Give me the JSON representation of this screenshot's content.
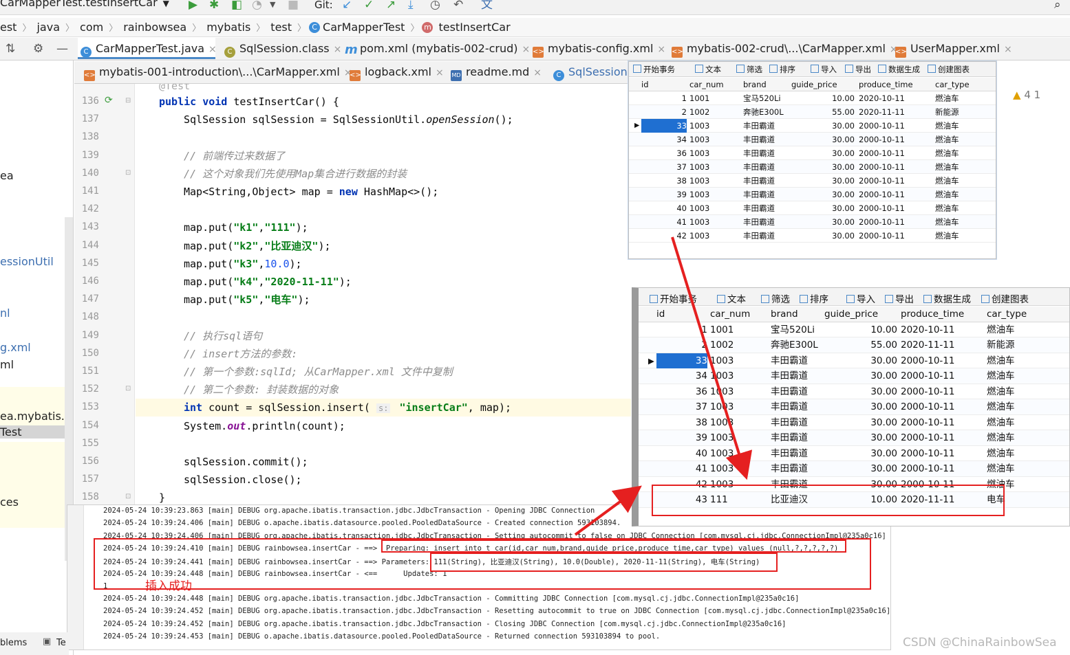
{
  "toolbar": {
    "run_config": "CarMapperTest.testInsertCar",
    "git_label": "Git:"
  },
  "breadcrumb": {
    "items": [
      "est",
      "java",
      "com",
      "rainbowsea",
      "mybatis",
      "test",
      "CarMapperTest",
      "testInsertCar"
    ]
  },
  "tabs_row1": [
    {
      "label": "CarMapperTest.java",
      "icon": "class-icon"
    },
    {
      "label": "SqlSession.class",
      "icon": "class-icon"
    },
    {
      "label": "pom.xml (mybatis-002-crud)",
      "icon": "maven-icon"
    },
    {
      "label": "mybatis-config.xml",
      "icon": "xml-icon"
    },
    {
      "label": "mybatis-002-crud\\...\\CarMapper.xml",
      "icon": "xml-icon"
    },
    {
      "label": "UserMapper.xml",
      "icon": "xml-icon"
    }
  ],
  "tabs_row2": [
    {
      "label": "mybatis-001-introduction\\...\\CarMapper.xml",
      "icon": "xml-icon"
    },
    {
      "label": "logback.xml",
      "icon": "xml-icon"
    },
    {
      "label": "readme.md",
      "icon": "markdown-icon"
    },
    {
      "label": "SqlSessionU",
      "icon": "class-icon"
    }
  ],
  "project_panel": {
    "items": [
      "ea",
      "essionUtil",
      "nl",
      "g.xml",
      "ml",
      "ea.mybatis.tes",
      "Test",
      "ces"
    ]
  },
  "editor": {
    "lines": [
      {
        "n": "136",
        "text": "public void testInsertCar() {"
      },
      {
        "n": "137",
        "text": "SqlSession sqlSession = SqlSessionUtil.openSession();"
      },
      {
        "n": "138",
        "text": ""
      },
      {
        "n": "139",
        "text": "// 前端传过来数据了"
      },
      {
        "n": "140",
        "text": "// 这个对象我们先使用Map集合进行数据的封装"
      },
      {
        "n": "141",
        "text": "Map<String,Object> map = new HashMap<>();"
      },
      {
        "n": "142",
        "text": ""
      },
      {
        "n": "143",
        "text": "map.put(\"k1\",\"111\");"
      },
      {
        "n": "144",
        "text": "map.put(\"k2\",\"比亚迪汉\");"
      },
      {
        "n": "145",
        "text": "map.put(\"k3\",10.0);"
      },
      {
        "n": "146",
        "text": "map.put(\"k4\",\"2020-11-11\");"
      },
      {
        "n": "147",
        "text": "map.put(\"k5\",\"电车\");"
      },
      {
        "n": "148",
        "text": ""
      },
      {
        "n": "149",
        "text": "// 执行sql语句"
      },
      {
        "n": "150",
        "text": "// insert方法的参数:"
      },
      {
        "n": "151",
        "text": "// 第一个参数:sqlId; 从CarMapper.xml 文件中复制"
      },
      {
        "n": "152",
        "text": "// 第二个参数: 封装数据的对象"
      },
      {
        "n": "153",
        "text": "int count = sqlSession.insert( s: \"insertCar\", map);"
      },
      {
        "n": "154",
        "text": "System.out.println(count);"
      },
      {
        "n": "155",
        "text": ""
      },
      {
        "n": "156",
        "text": "sqlSession.commit();"
      },
      {
        "n": "157",
        "text": "sqlSession.close();"
      },
      {
        "n": "158",
        "text": "}"
      }
    ],
    "inspections": "4  1"
  },
  "console": {
    "lines": [
      "2024-05-24 10:39:23.863 [main] DEBUG org.apache.ibatis.transaction.jdbc.JdbcTransaction - Opening JDBC Connection",
      "2024-05-24 10:39:24.406 [main] DEBUG o.apache.ibatis.datasource.pooled.PooledDataSource - Created connection 593103894.",
      "2024-05-24 10:39:24.406 [main] DEBUG org.apache.ibatis.transaction.jdbc.JdbcTransaction - Setting autocommit to false on JDBC Connection [com.mysql.cj.jdbc.ConnectionImpl@235a0c16]",
      "2024-05-24 10:39:24.410 [main] DEBUG rainbowsea.insertCar - ==>  Preparing: insert into t_car(id,car_num,brand,guide_price,produce_time,car_type) values (null,?,?,?,?,?)",
      "2024-05-24 10:39:24.441 [main] DEBUG rainbowsea.insertCar - ==> Parameters: 111(String), 比亚迪汉(String), 10.0(Double), 2020-11-11(String), 电车(String)",
      "2024-05-24 10:39:24.448 [main] DEBUG rainbowsea.insertCar - <==      Updates: 1",
      "1",
      "2024-05-24 10:39:24.448 [main] DEBUG org.apache.ibatis.transaction.jdbc.JdbcTransaction - Committing JDBC Connection [com.mysql.cj.jdbc.ConnectionImpl@235a0c16]",
      "2024-05-24 10:39:24.452 [main] DEBUG org.apache.ibatis.transaction.jdbc.JdbcTransaction - Resetting autocommit to true on JDBC Connection [com.mysql.cj.jdbc.ConnectionImpl@235a0c16]",
      "2024-05-24 10:39:24.452 [main] DEBUG org.apache.ibatis.transaction.jdbc.JdbcTransaction - Closing JDBC Connection [com.mysql.cj.jdbc.ConnectionImpl@235a0c16]",
      "2024-05-24 10:39:24.453 [main] DEBUG o.apache.ibatis.datasource.pooled.PooledDataSource - Returned connection 593103894 to pool."
    ],
    "annotation": "插入成功"
  },
  "bottom_tabs": [
    "blems",
    "Te"
  ],
  "db_toolbar": [
    "开始事务",
    "文本",
    "筛选",
    "排序",
    "导入",
    "导出",
    "数据生成",
    "创建图表"
  ],
  "db_columns": [
    "id",
    "car_num",
    "brand",
    "guide_price",
    "produce_time",
    "car_type"
  ],
  "db_before": [
    [
      "1",
      "1001",
      "宝马520Li",
      "10.00",
      "2020-10-11",
      "燃油车"
    ],
    [
      "2",
      "1002",
      "奔驰E300L",
      "55.00",
      "2020-11-11",
      "新能源"
    ],
    [
      "33",
      "1003",
      "丰田霸道",
      "30.00",
      "2000-10-11",
      "燃油车"
    ],
    [
      "34",
      "1003",
      "丰田霸道",
      "30.00",
      "2000-10-11",
      "燃油车"
    ],
    [
      "36",
      "1003",
      "丰田霸道",
      "30.00",
      "2000-10-11",
      "燃油车"
    ],
    [
      "37",
      "1003",
      "丰田霸道",
      "30.00",
      "2000-10-11",
      "燃油车"
    ],
    [
      "38",
      "1003",
      "丰田霸道",
      "30.00",
      "2000-10-11",
      "燃油车"
    ],
    [
      "39",
      "1003",
      "丰田霸道",
      "30.00",
      "2000-10-11",
      "燃油车"
    ],
    [
      "40",
      "1003",
      "丰田霸道",
      "30.00",
      "2000-10-11",
      "燃油车"
    ],
    [
      "41",
      "1003",
      "丰田霸道",
      "30.00",
      "2000-10-11",
      "燃油车"
    ],
    [
      "42",
      "1003",
      "丰田霸道",
      "30.00",
      "2000-10-11",
      "燃油车"
    ]
  ],
  "db_after": [
    [
      "1",
      "1001",
      "宝马520Li",
      "10.00",
      "2020-10-11",
      "燃油车"
    ],
    [
      "2",
      "1002",
      "奔驰E300L",
      "55.00",
      "2020-11-11",
      "新能源"
    ],
    [
      "33",
      "1003",
      "丰田霸道",
      "30.00",
      "2000-10-11",
      "燃油车"
    ],
    [
      "34",
      "1003",
      "丰田霸道",
      "30.00",
      "2000-10-11",
      "燃油车"
    ],
    [
      "36",
      "1003",
      "丰田霸道",
      "30.00",
      "2000-10-11",
      "燃油车"
    ],
    [
      "37",
      "1003",
      "丰田霸道",
      "30.00",
      "2000-10-11",
      "燃油车"
    ],
    [
      "38",
      "1003",
      "丰田霸道",
      "30.00",
      "2000-10-11",
      "燃油车"
    ],
    [
      "39",
      "1003",
      "丰田霸道",
      "30.00",
      "2000-10-11",
      "燃油车"
    ],
    [
      "40",
      "1003",
      "丰田霸道",
      "30.00",
      "2000-10-11",
      "燃油车"
    ],
    [
      "41",
      "1003",
      "丰田霸道",
      "30.00",
      "2000-10-11",
      "燃油车"
    ],
    [
      "42",
      "1003",
      "丰田霸道",
      "30.00",
      "2000-10-11",
      "燃油车"
    ],
    [
      "43",
      "111",
      "比亚迪汉",
      "10.00",
      "2020-11-11",
      "电车"
    ]
  ],
  "watermark": "CSDN @ChinaRainbowSea",
  "colors": {
    "annotation_red": "#e52020",
    "selection_blue": "#1f6fd1",
    "keyword": "#0033b3",
    "string": "#067d17"
  }
}
